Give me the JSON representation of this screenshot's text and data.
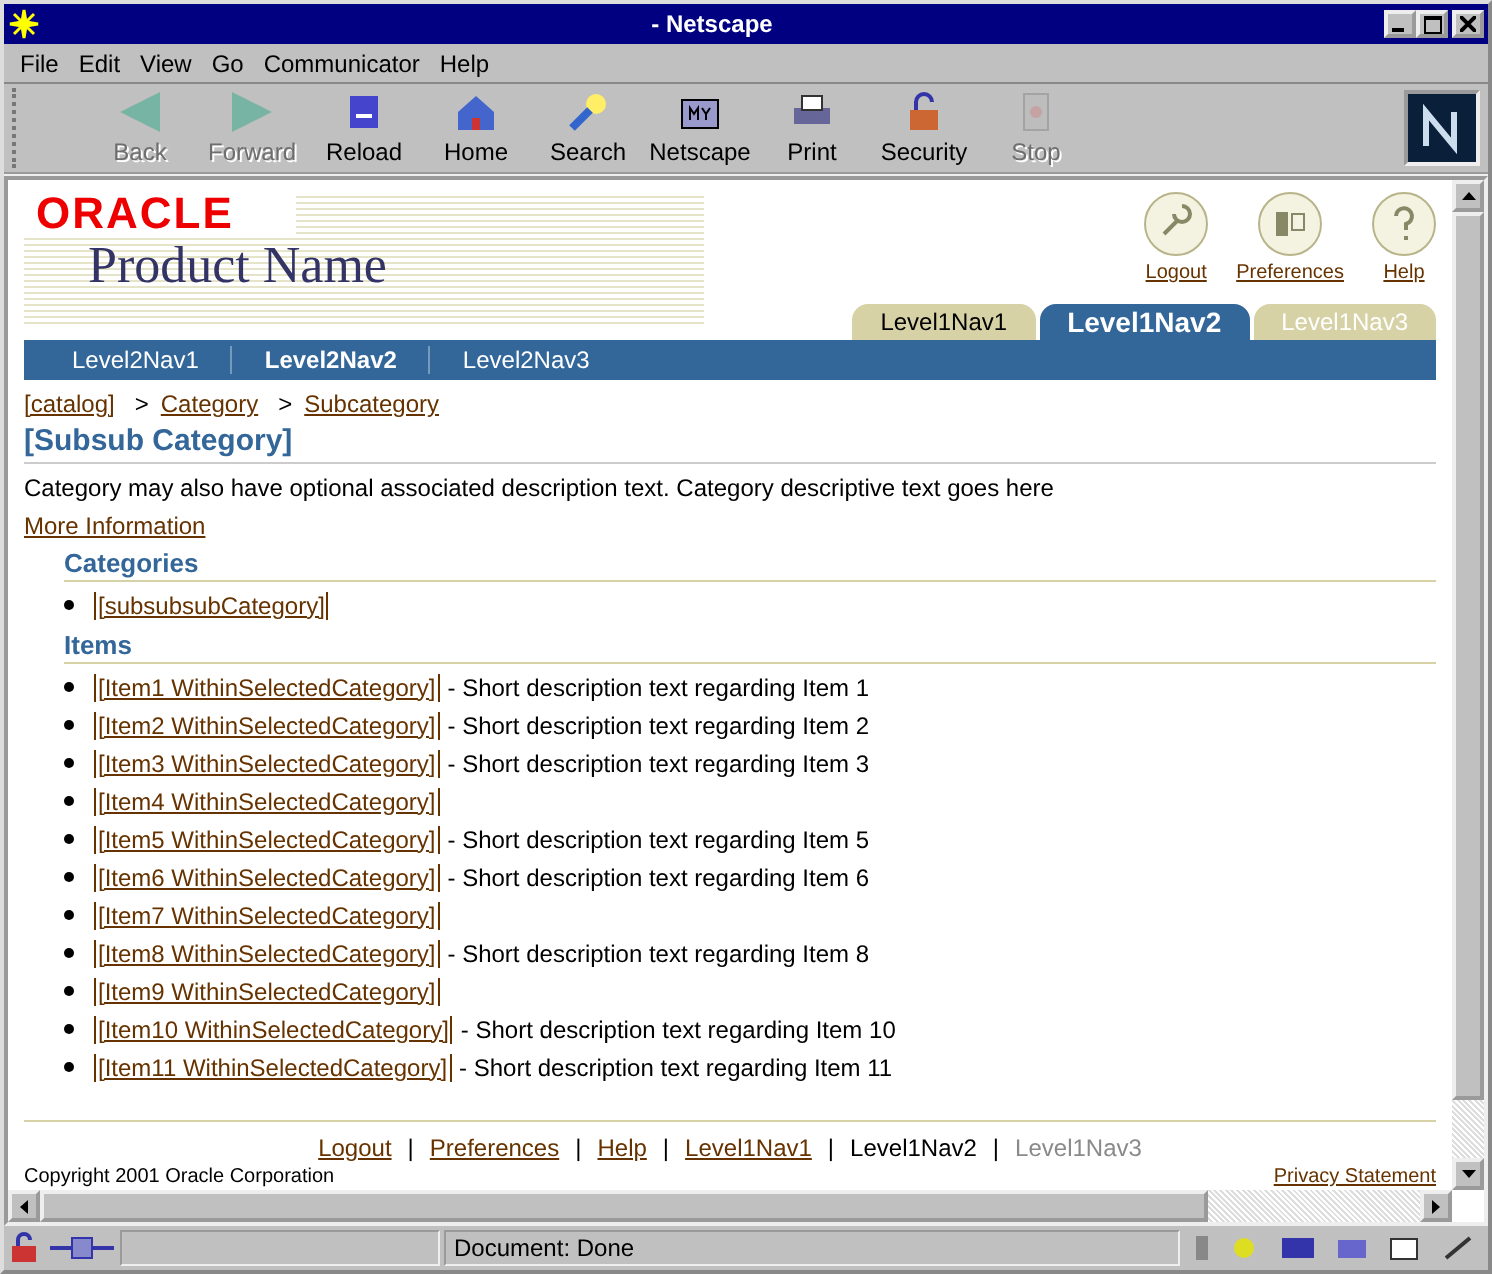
{
  "window": {
    "title": "- Netscape"
  },
  "menu": [
    {
      "label": "File"
    },
    {
      "label": "Edit"
    },
    {
      "label": "View"
    },
    {
      "label": "Go"
    },
    {
      "label": "Communicator"
    },
    {
      "label": "Help"
    }
  ],
  "toolbar": [
    {
      "label": "Back",
      "kind": "back",
      "disabled": true
    },
    {
      "label": "Forward",
      "kind": "forward",
      "disabled": true
    },
    {
      "label": "Reload",
      "kind": "reload",
      "disabled": false
    },
    {
      "label": "Home",
      "kind": "home",
      "disabled": false
    },
    {
      "label": "Search",
      "kind": "search",
      "disabled": false
    },
    {
      "label": "Netscape",
      "kind": "my",
      "disabled": false
    },
    {
      "label": "Print",
      "kind": "print",
      "disabled": false
    },
    {
      "label": "Security",
      "kind": "security",
      "disabled": false
    },
    {
      "label": "Stop",
      "kind": "stop",
      "disabled": true
    }
  ],
  "header": {
    "logo": "ORACLE",
    "product_name": "Product Name"
  },
  "global_buttons": [
    {
      "label": "Logout",
      "kind": "logout"
    },
    {
      "label": "Preferences",
      "kind": "preferences"
    },
    {
      "label": "Help",
      "kind": "help"
    }
  ],
  "tabs": [
    {
      "label": "Level1Nav1",
      "selected": false,
      "disabled": false
    },
    {
      "label": "Level1Nav2",
      "selected": true,
      "disabled": false
    },
    {
      "label": "Level1Nav3",
      "selected": false,
      "disabled": true
    }
  ],
  "subtabs": [
    {
      "label": "Level2Nav1",
      "selected": false
    },
    {
      "label": "Level2Nav2",
      "selected": true
    },
    {
      "label": "Level2Nav3",
      "selected": false
    }
  ],
  "breadcrumb": {
    "separator": ">",
    "links": [
      "[catalog]",
      "Category",
      "Subcategory"
    ]
  },
  "heading": "[Subsub Category]",
  "description": "Category may also have optional associated description text. Category descriptive text goes here",
  "more_info": "More Information",
  "categories": {
    "title": "Categories",
    "items": [
      "[subsubsubCategory]"
    ]
  },
  "items": {
    "title": "Items",
    "rows": [
      {
        "link": "[Item1 WithinSelectedCategory]",
        "text": "- Short description text regarding Item 1"
      },
      {
        "link": "[Item2 WithinSelectedCategory]",
        "text": "- Short description text regarding Item 2"
      },
      {
        "link": "[Item3 WithinSelectedCategory]",
        "text": "- Short description text regarding Item 3"
      },
      {
        "link": "[Item4 WithinSelectedCategory]"
      },
      {
        "link": "[Item5 WithinSelectedCategory]",
        "text": "- Short description text regarding Item 5"
      },
      {
        "link": "[Item6 WithinSelectedCategory]",
        "text": "- Short description text regarding Item 6"
      },
      {
        "link": "[Item7 WithinSelectedCategory]"
      },
      {
        "link": "[Item8 WithinSelectedCategory]",
        "text": "- Short description text regarding Item 8"
      },
      {
        "link": "[Item9 WithinSelectedCategory]"
      },
      {
        "link": "[Item10 WithinSelectedCategory]",
        "text": "- Short description text regarding Item 10"
      },
      {
        "link": "[Item11 WithinSelectedCategory]",
        "text": "- Short description text regarding Item 11"
      }
    ]
  },
  "footer": {
    "separator": "|",
    "links": [
      {
        "label": "Logout",
        "kind": "link"
      },
      {
        "label": "Preferences",
        "kind": "link"
      },
      {
        "label": "Help",
        "kind": "link"
      },
      {
        "label": "Level1Nav1",
        "kind": "link"
      },
      {
        "label": "Level1Nav2",
        "kind": "current"
      },
      {
        "label": "Level1Nav3",
        "kind": "disabled"
      }
    ],
    "copyright": "Copyright 2001 Oracle Corporation",
    "privacy": "Privacy Statement"
  },
  "status_bar": {
    "text": "Document: Done"
  }
}
